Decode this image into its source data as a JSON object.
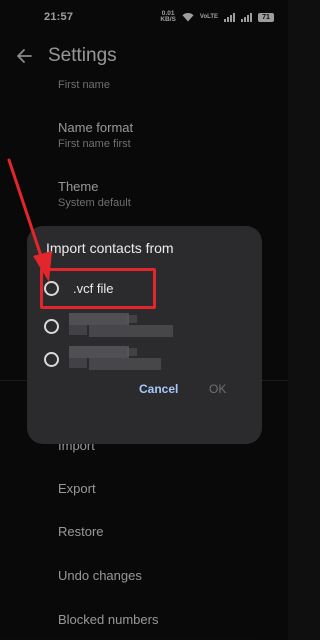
{
  "status": {
    "time": "21:57",
    "net_speed_value": "0.01",
    "net_speed_unit": "KB/S",
    "volte": "VoLTE",
    "battery": "71"
  },
  "header": {
    "title": "Settings",
    "back_icon": "arrow-back-icon"
  },
  "settings": {
    "first_name_partial": "First name",
    "name_format_title": "Name format",
    "name_format_value": "First name first",
    "theme_title": "Theme",
    "theme_value": "System default",
    "import": "Import",
    "export": "Export",
    "restore": "Restore",
    "undo_changes": "Undo changes",
    "blocked_numbers": "Blocked numbers"
  },
  "dialog": {
    "title": "Import contacts from",
    "options": [
      ".vcf file",
      "",
      ""
    ],
    "cancel_label": "Cancel",
    "ok_label": "OK"
  },
  "colors": {
    "highlight": "#e2262b",
    "accent": "#a8c7fa"
  }
}
